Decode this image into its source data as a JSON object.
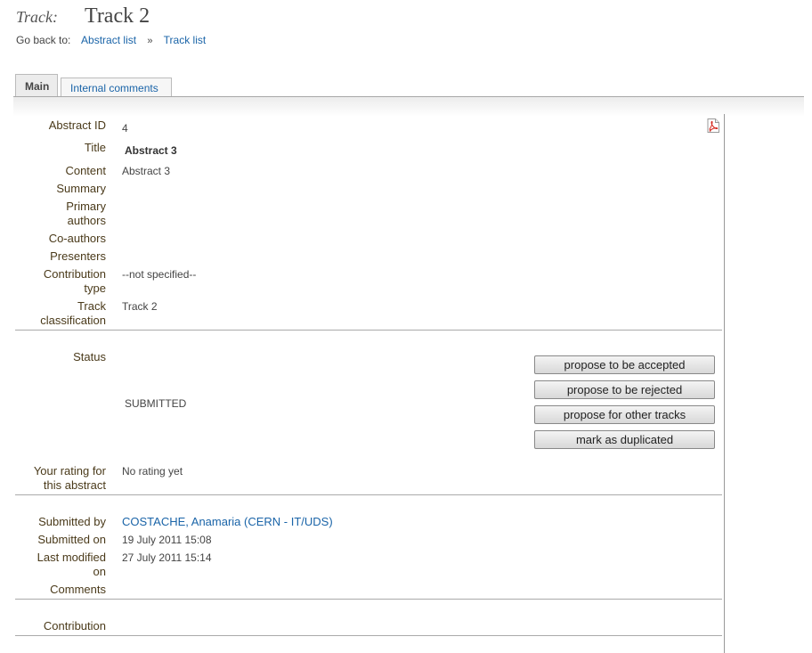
{
  "header": {
    "track_keyword": "Track:",
    "track_name": "Track 2",
    "goback_label": "Go back to:",
    "link_abstract_list": "Abstract list",
    "separator": "»",
    "link_track_list": "Track list"
  },
  "tabs": [
    {
      "label": "Main",
      "active": true
    },
    {
      "label": "Internal comments",
      "active": false
    }
  ],
  "details": {
    "abstract_id_label": "Abstract ID",
    "abstract_id": "4",
    "title_label": "Title",
    "title": "Abstract 3",
    "content_label": "Content",
    "content": "Abstract 3",
    "summary_label": "Summary",
    "primary_authors_label_1": "Primary",
    "primary_authors_label_2": "authors",
    "coauthors_label": "Co-authors",
    "presenters_label": "Presenters",
    "contribution_type_label_1": "Contribution",
    "contribution_type_label_2": "type",
    "contribution_type": "--not specified--",
    "track_class_label_1": "Track",
    "track_class_label_2": "classification",
    "track_classification": "Track 2"
  },
  "status": {
    "label": "Status",
    "value": "SUBMITTED",
    "actions": [
      "propose to be accepted",
      "propose to be rejected",
      "propose for other tracks",
      "mark as duplicated"
    ]
  },
  "rating": {
    "label_1": "Your rating for",
    "label_2": "this abstract",
    "value": "No rating yet"
  },
  "submission": {
    "submitted_by_label": "Submitted by",
    "submitted_by": "COSTACHE, Anamaria (CERN - IT/UDS)",
    "submitted_on_label": "Submitted on",
    "submitted_on": "19 July 2011 15:08",
    "last_modified_label_1": "Last modified",
    "last_modified_label_2": "on",
    "last_modified": "27 July 2011 15:14",
    "comments_label": "Comments"
  },
  "contribution": {
    "label": "Contribution"
  },
  "icons": {
    "pdf": "pdf-icon"
  },
  "colors": {
    "link": "#1a64a8",
    "label": "#4a3a1a",
    "pdf_red": "#d4281e"
  }
}
